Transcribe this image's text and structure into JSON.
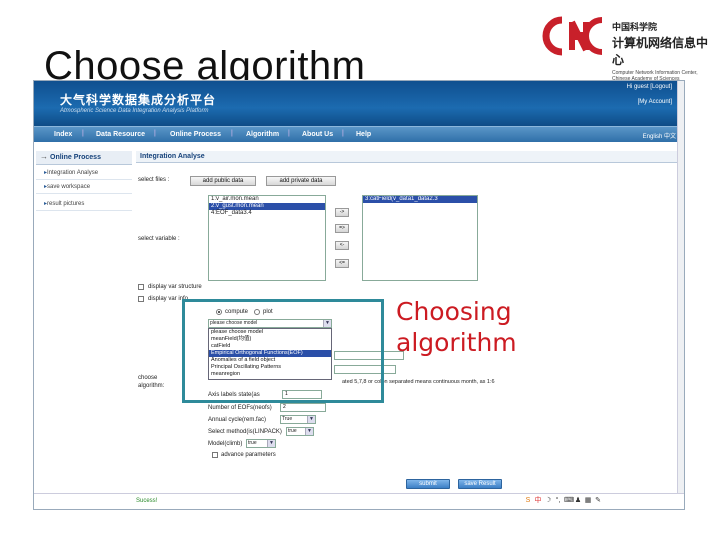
{
  "slide": {
    "title": "Choose algorithm"
  },
  "logo": {
    "cn_line1": "中国科学院",
    "cn_line2": "计算机网络信息中心",
    "en": "Computer Network Information Center, Chinese Academy of Sciences"
  },
  "app": {
    "banner_cn": "大气科学数据集成分析平台",
    "banner_en": "Atmospheric Science Data Integration Analysis Platform",
    "user_greet": "Hi guest [Logout]",
    "my_account": "[My Account]",
    "nav": [
      "Index",
      "Data Resource",
      "Online Process",
      "Algorithm",
      "About Us",
      "Help"
    ],
    "lang": "English  中文"
  },
  "sidebar": {
    "head": "Online Process",
    "items": [
      "Integration Analyse",
      "save workspace",
      "result pictures"
    ]
  },
  "content": {
    "head": "Integration Analyse",
    "select_files_label": "select files :",
    "add_public_btn": "add public data",
    "add_private_btn": "add private data",
    "files_list": [
      "1:v_air.mon.mean",
      "2:v_gust.mon.mean",
      "4:EOF_data3.4"
    ],
    "files_selected_index": 1,
    "selected_vars_list": [
      "3:catField(v_data1_data2.3"
    ],
    "select_variable_label": "select variable :",
    "arrow_buttons": [
      "->",
      "=>",
      "<-",
      "<="
    ],
    "display_var_structure": "display var structure",
    "display_var_info": "display var info",
    "radio_compute": "compute",
    "radio_plot": "plot",
    "model_select": "please choose model",
    "dropdown_items": [
      "please choose model",
      "meanField(均值)",
      "catField",
      "Empirical Orthogonal Functions(EOF)",
      "Anomalies of a field object",
      "Principal Oscillating Patterns",
      "meanregion"
    ],
    "dropdown_highlight_index": 3,
    "choose_algorithm_label": "choose algorithm:",
    "months_hint": "ated 5,7,8 or colon separated means continuous month, as 1:6",
    "axis_labels_label": "Axis labels state(as",
    "axis_labels_value": "1",
    "num_eofs_label": "Number of EOFs(neofs)",
    "num_eofs_value": "2",
    "annual_cycle_label": "Annual cycle(rem.fac)",
    "annual_cycle_value": "True",
    "select_method_label": "Select method(is(LINPACK)",
    "select_method_value": "true",
    "model_climb_label": "Model(climb)",
    "model_climb_value": "true",
    "advance_params": "advance parameters",
    "submit_btn": "submit",
    "save_result_btn": "save Result"
  },
  "callout": {
    "line1": "Choosing",
    "line2": "algorithm"
  },
  "status": {
    "text": "Sucess!"
  },
  "colors": {
    "banner": "#1c6bb0",
    "callout": "#cc1b22",
    "highlight_box": "#2e8a9a",
    "selection": "#2b4fa8"
  }
}
